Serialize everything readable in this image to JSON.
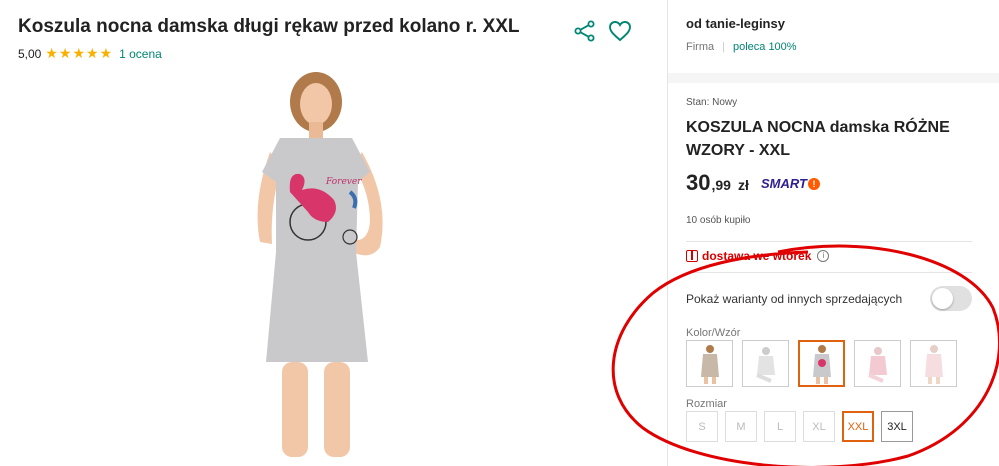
{
  "product": {
    "title": "Koszula nocna damska długi rękaw przed kolano r. XXL",
    "rating_score": "5,00",
    "rating_stars": "★★★★★",
    "rating_count": "1 ocena"
  },
  "icons": {
    "share": "share-icon",
    "favorite": "heart-icon"
  },
  "seller": {
    "name": "od tanie-leginsy",
    "type": "Firma",
    "recommend": "poleca 100%"
  },
  "offer": {
    "condition": "Stan: Nowy",
    "title": "KOSZULA NOCNA damska RÓŻNE WZORY - XXL",
    "price_int": "30",
    "price_dec": ",99",
    "currency": "zł",
    "smart_label": "SMART",
    "smart_mark": "!",
    "bought": "10 osób kupiło",
    "delivery": "dostawa we wtorek",
    "delivery_info": "i"
  },
  "variants": {
    "toggle_label": "Pokaż warianty od innych sprzedających",
    "toggle_on": false,
    "color_label": "Kolor/Wzór",
    "color_count": 5,
    "color_selected_index": 2,
    "size_label": "Rozmiar",
    "sizes": [
      "S",
      "M",
      "L",
      "XL",
      "XXL",
      "3XL"
    ],
    "size_selected": "XXL"
  },
  "colors": {
    "accent_green": "#008673",
    "star": "#f9b100",
    "delivery_red": "#d40000",
    "selection_orange": "#e0620f",
    "annotation_red": "#e00000",
    "smart_purple": "#2e1f8f"
  }
}
